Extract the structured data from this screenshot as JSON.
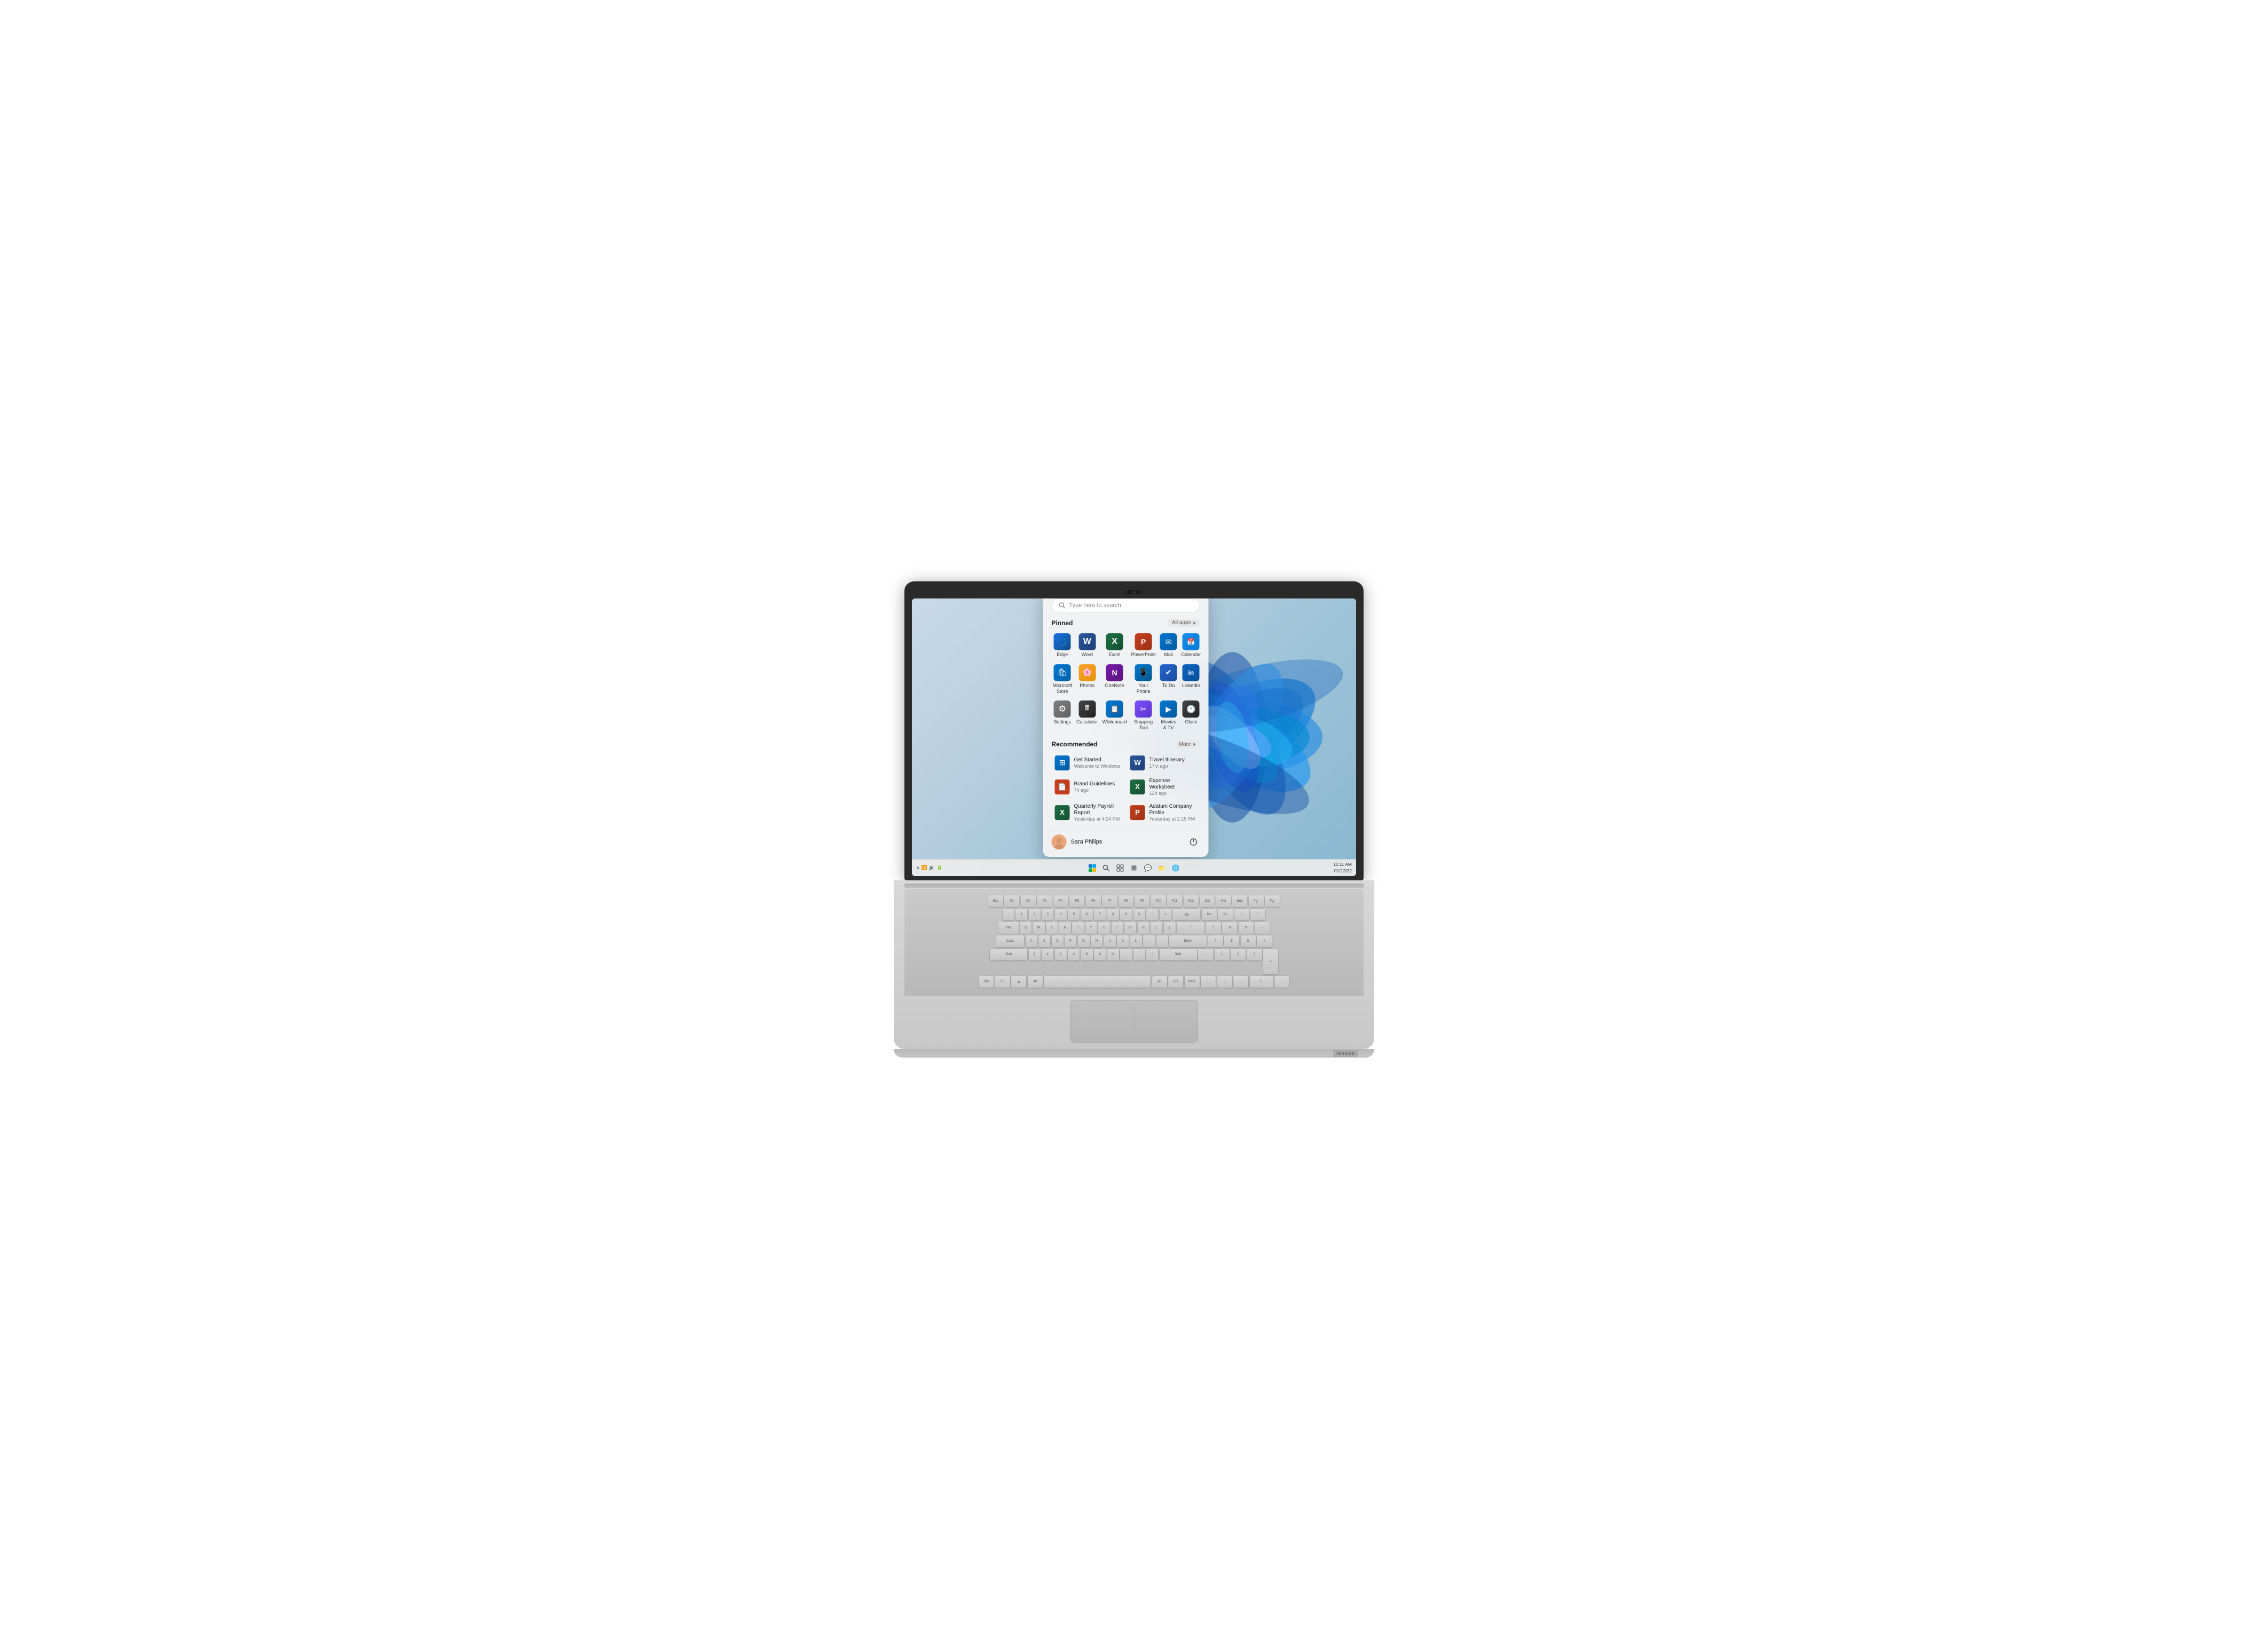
{
  "laptop": {
    "brand": "lenovo"
  },
  "screen": {
    "wallpaper": "Windows 11 blue bloom"
  },
  "startmenu": {
    "search_placeholder": "Type here to search",
    "pinned_label": "Pinned",
    "all_apps_label": "All apps",
    "recommended_label": "Recommended",
    "more_label": "More",
    "user_name": "Sara Philips",
    "pinned_apps": [
      {
        "id": "edge",
        "label": "Edge",
        "icon": "🌐",
        "class": "icon-edge"
      },
      {
        "id": "word",
        "label": "Word",
        "icon": "W",
        "class": "icon-word"
      },
      {
        "id": "excel",
        "label": "Excel",
        "icon": "X",
        "class": "icon-excel"
      },
      {
        "id": "powerpoint",
        "label": "PowerPoint",
        "icon": "P",
        "class": "icon-powerpoint"
      },
      {
        "id": "mail",
        "label": "Mail",
        "icon": "✉",
        "class": "icon-mail"
      },
      {
        "id": "calendar",
        "label": "Calendar",
        "icon": "📅",
        "class": "icon-calendar"
      },
      {
        "id": "store",
        "label": "Microsoft Store",
        "icon": "🛒",
        "class": "icon-store"
      },
      {
        "id": "photos",
        "label": "Photos",
        "icon": "🖼",
        "class": "icon-photos"
      },
      {
        "id": "onenote",
        "label": "OneNote",
        "icon": "N",
        "class": "icon-onenote"
      },
      {
        "id": "yourphone",
        "label": "Your Phone",
        "icon": "📱",
        "class": "icon-yourphone"
      },
      {
        "id": "todo",
        "label": "To Do",
        "icon": "✓",
        "class": "icon-todo"
      },
      {
        "id": "linkedin",
        "label": "LinkedIn",
        "icon": "in",
        "class": "icon-linkedin"
      },
      {
        "id": "settings",
        "label": "Settings",
        "icon": "⚙",
        "class": "icon-settings"
      },
      {
        "id": "calculator",
        "label": "Calculator",
        "icon": "=",
        "class": "icon-calculator"
      },
      {
        "id": "whiteboard",
        "label": "Whiteboard",
        "icon": "📋",
        "class": "icon-whiteboard"
      },
      {
        "id": "snipping",
        "label": "Snipping Tool",
        "icon": "✂",
        "class": "icon-snipping"
      },
      {
        "id": "movies",
        "label": "Movies & TV",
        "icon": "▶",
        "class": "icon-movies"
      },
      {
        "id": "clock",
        "label": "Clock",
        "icon": "🕐",
        "class": "icon-clock"
      }
    ],
    "recommended_items": [
      {
        "id": "get-started",
        "label": "Get Started",
        "sublabel": "Welcome to Windows",
        "icon": "🪟",
        "class": "icon-store"
      },
      {
        "id": "travel",
        "label": "Travel Itinerary",
        "sublabel": "17m ago",
        "icon": "W",
        "class": "icon-word"
      },
      {
        "id": "brand",
        "label": "Brand Guidelines",
        "sublabel": "7h ago",
        "icon": "📄",
        "class": "icon-powerpoint"
      },
      {
        "id": "expense",
        "label": "Expense Worksheet",
        "sublabel": "12h ago",
        "icon": "X",
        "class": "icon-excel"
      },
      {
        "id": "payroll",
        "label": "Quarterly Payroll Report",
        "sublabel": "Yesterday at 4:24 PM",
        "icon": "X",
        "class": "icon-excel"
      },
      {
        "id": "adatum",
        "label": "Adatum Company Profile",
        "sublabel": "Yesterday at 2:15 PM",
        "icon": "P",
        "class": "icon-powerpoint"
      }
    ]
  },
  "taskbar": {
    "datetime": "01/12/22",
    "time": "11:11 AM",
    "icons": [
      "⊞",
      "🔍",
      "💬",
      "⊟",
      "💬",
      "📁",
      "🌐"
    ]
  }
}
